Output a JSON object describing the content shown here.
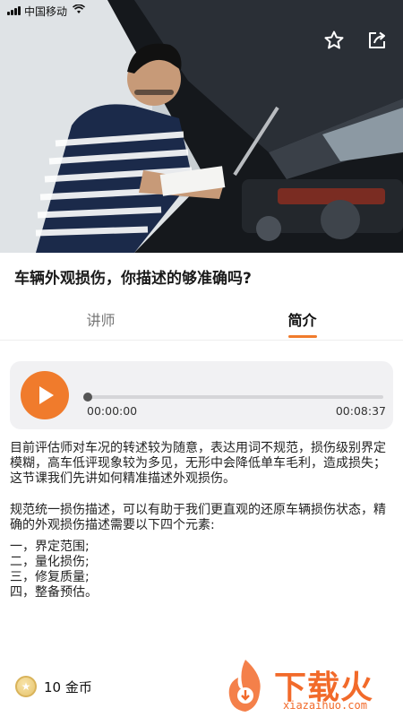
{
  "status_bar": {
    "carrier": "中国移动"
  },
  "hero": {
    "image_alt": ""
  },
  "course": {
    "title": "车辆外观损伤，你描述的够准确吗?"
  },
  "tabs": [
    {
      "label": "讲师",
      "active": false
    },
    {
      "label": "简介",
      "active": true
    }
  ],
  "player": {
    "current_time": "00:00:00",
    "total_time": "00:08:37",
    "progress": 0
  },
  "description": {
    "paragraph1": "目前评估师对车况的转述较为随意，表达用词不规范，损伤级别界定模糊，高车低评现象较为多见，无形中会降低单车毛利，造成损失；这节课我们先讲如何精准描述外观损伤。",
    "paragraph2": "规范统一损伤描述，可以有助于我们更直观的还原车辆损伤状态，精确的外观损伤描述需要以下四个元素:",
    "items": [
      "一，界定范围;",
      "二，量化损伤;",
      "三，修复质量;",
      "四，整备预估。"
    ]
  },
  "footer": {
    "coins": "10 金币"
  },
  "watermark": {
    "brand": "下载火",
    "domain": "xiazaihuo.com"
  },
  "colors": {
    "accent": "#f07b2c",
    "player_bg": "#f1f1f3"
  }
}
